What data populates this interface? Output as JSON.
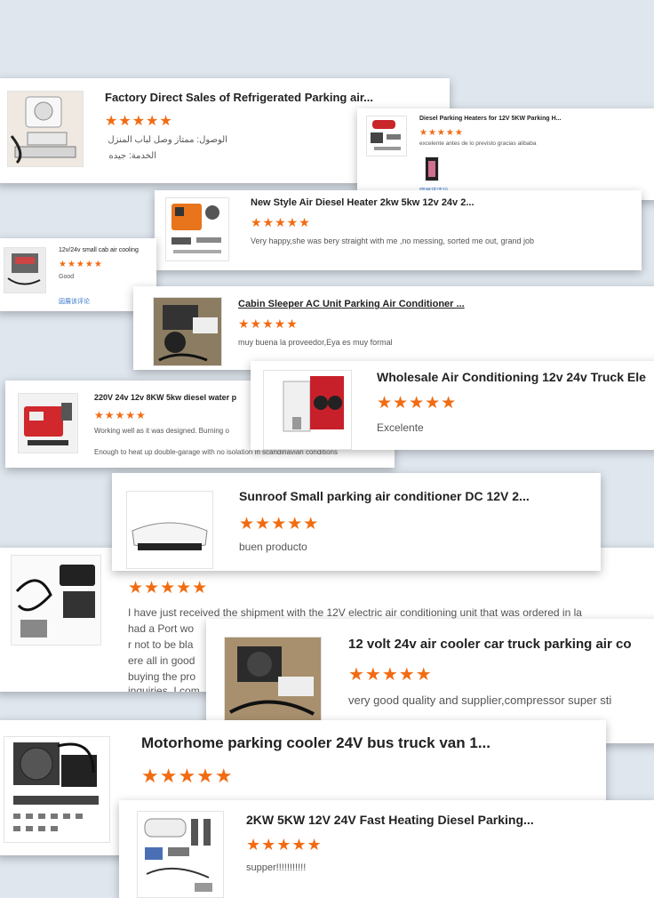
{
  "reviews": [
    {
      "title": "Factory Direct Sales of Refrigerated Parking air...",
      "stars": "★★★★★",
      "text1": "الوصول: ممتاز وصل لباب المنزل",
      "text2": "الخدمة: جيده"
    },
    {
      "title": "Diesel Parking Heaters for 12V 5KW Parking H...",
      "stars": "★★★★★",
      "text1": "excelente antes de lo previsto gracias alibaba",
      "link": "図展该评论"
    },
    {
      "title": "New Style Air Diesel Heater 2kw 5kw 12v 24v 2...",
      "stars": "★★★★★",
      "text1": "Very happy,she was bery straight with me ,no messing, sorted me out, grand job"
    },
    {
      "title": "12v/24v small cab air cooling",
      "stars": "★★★★★",
      "text1": "Good",
      "link": "図展该评论"
    },
    {
      "title": "Cabin Sleeper AC Unit Parking Air Conditioner ...",
      "stars": "★★★★★",
      "text1": "muy buena la proveedor,Eya es muy formal"
    },
    {
      "title": "220V 24v 12v 8KW 5kw diesel water p",
      "stars": "★★★★★",
      "text1": "Working well as it was designed. Burning o",
      "text2": "Enough to heat up double-garage with no isolation in scandinavian conditions"
    },
    {
      "title": "Wholesale Air Conditioning 12v 24v Truck Ele",
      "stars": "★★★★★",
      "text1": "Excelente"
    },
    {
      "title": "Sunroof Small parking air conditioner DC 12V 2...",
      "stars": "★★★★★",
      "text1": "buen producto"
    },
    {
      "title": "",
      "stars": "★★★★★",
      "text1": "I have just received the shipment with the 12V electric air conditioning unit that was ordered in la",
      "text2": "had a Port wo",
      "text3": "r not to be bla",
      "text4": "ere all in good",
      "text5": "buying the pro",
      "text6": "inquiries. I com"
    },
    {
      "title": "12 volt 24v air cooler car truck parking air co",
      "stars": "★★★★★",
      "text1": "very good quality and supplier,compressor super sti"
    },
    {
      "title": "Motorhome parking cooler 24V bus truck van 1...",
      "stars": "★★★★★"
    },
    {
      "title": "2KW 5KW 12V 24V Fast Heating Diesel Parking...",
      "stars": "★★★★★",
      "text1": "supper!!!!!!!!!!!"
    }
  ],
  "colors": {
    "star": "#f26b12",
    "link": "#3a78c8",
    "background": "#dfe6ee"
  },
  "icons": [
    "ac-unit-image",
    "heater-kit-image",
    "cooler-kit-image"
  ]
}
